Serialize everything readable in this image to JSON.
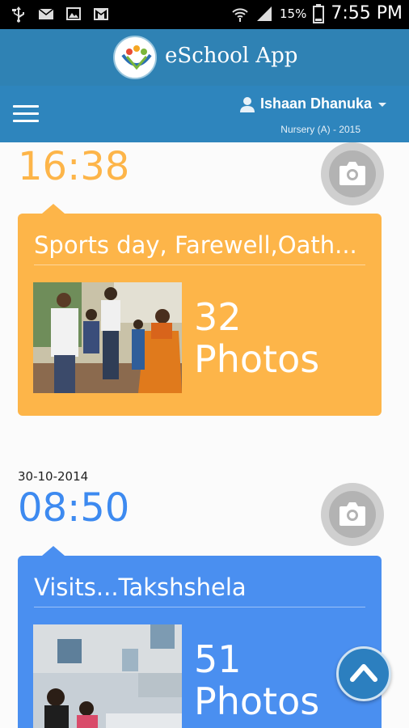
{
  "status_bar": {
    "battery_percent": "15%",
    "time": "7:55 PM",
    "left_icons": [
      "usb-icon",
      "mail-icon",
      "image-icon",
      "gmail-icon"
    ],
    "right_icons": [
      "wifi-icon",
      "signal-icon",
      "battery-icon"
    ]
  },
  "app_bar": {
    "title": "eSchool App",
    "logo": "eschool-logo"
  },
  "user_bar": {
    "user_name": "Ishaan Dhanuka",
    "class_info": "Nursery (A) - 2015",
    "menu_icon": "hamburger-menu-icon"
  },
  "feed": {
    "entries": [
      {
        "date": "",
        "time": "16:38",
        "title": "Sports day, Farewell,Oath...",
        "count_number": "32",
        "count_label": "Photos",
        "color": "#fdb549"
      },
      {
        "date": "30-10-2014",
        "time": "08:50",
        "title": "Visits...Takshshela",
        "count_number": "51",
        "count_label": "Photos",
        "color": "#4a8ff0"
      }
    ]
  },
  "colors": {
    "app_bar": "#2f82b4",
    "user_bar": "#2e85bd",
    "orange_time": "#fdb549",
    "blue_time": "#3d8af0"
  }
}
